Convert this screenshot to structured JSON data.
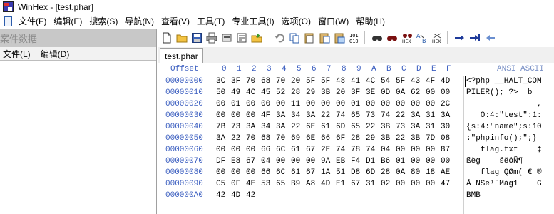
{
  "title": {
    "text": "WinHex - [test.phar]"
  },
  "menu": {
    "items": [
      "文件(F)",
      "编辑(E)",
      "搜索(S)",
      "导航(N)",
      "查看(V)",
      "工具(T)",
      "专业工具(I)",
      "选项(O)",
      "窗口(W)",
      "帮助(H)"
    ]
  },
  "left_panel": {
    "header": "案件数据",
    "menu": [
      "文件(L)",
      "编辑(D)"
    ]
  },
  "toolbar": {
    "icons": [
      "new-file-icon",
      "open-folder-icon",
      "save-icon",
      "print-icon",
      "properties-icon",
      "run-icon",
      "open-icon",
      "undo-icon",
      "copy-icon",
      "clipboard-icon",
      "paste-icon",
      "paste-write-icon",
      "binary-icon",
      "find-icon",
      "find-text-icon",
      "find-hex-icon",
      "replace-text-icon",
      "replace-hex-icon",
      "goto-offset-icon",
      "goto-icon",
      "back-icon"
    ]
  },
  "tab": {
    "label": "test.phar"
  },
  "hex": {
    "offset_header": "Offset",
    "col_headers": [
      "0",
      "1",
      "2",
      "3",
      "4",
      "5",
      "6",
      "7",
      "8",
      "9",
      "A",
      "B",
      "C",
      "D",
      "E",
      "F"
    ],
    "ascii_header": "ANSI ASCII",
    "rows": [
      {
        "offset": "00000000",
        "bytes": [
          "3C",
          "3F",
          "70",
          "68",
          "70",
          "20",
          "5F",
          "5F",
          "48",
          "41",
          "4C",
          "54",
          "5F",
          "43",
          "4F",
          "4D"
        ],
        "ascii": "<?php __HALT_COM"
      },
      {
        "offset": "00000010",
        "bytes": [
          "50",
          "49",
          "4C",
          "45",
          "52",
          "28",
          "29",
          "3B",
          "20",
          "3F",
          "3E",
          "0D",
          "0A",
          "62",
          "00",
          "00"
        ],
        "ascii": "PILER(); ?>  b"
      },
      {
        "offset": "00000020",
        "bytes": [
          "00",
          "01",
          "00",
          "00",
          "00",
          "11",
          "00",
          "00",
          "00",
          "01",
          "00",
          "00",
          "00",
          "00",
          "00",
          "2C"
        ],
        "ascii": "               ,"
      },
      {
        "offset": "00000030",
        "bytes": [
          "00",
          "00",
          "00",
          "4F",
          "3A",
          "34",
          "3A",
          "22",
          "74",
          "65",
          "73",
          "74",
          "22",
          "3A",
          "31",
          "3A"
        ],
        "ascii": "   O:4:\"test\":1:"
      },
      {
        "offset": "00000040",
        "bytes": [
          "7B",
          "73",
          "3A",
          "34",
          "3A",
          "22",
          "6E",
          "61",
          "6D",
          "65",
          "22",
          "3B",
          "73",
          "3A",
          "31",
          "30"
        ],
        "ascii": "{s:4:\"name\";s:10"
      },
      {
        "offset": "00000050",
        "bytes": [
          "3A",
          "22",
          "70",
          "68",
          "70",
          "69",
          "6E",
          "66",
          "6F",
          "28",
          "29",
          "3B",
          "22",
          "3B",
          "7D",
          "08"
        ],
        "ascii": ":\"phpinfo();\";}"
      },
      {
        "offset": "00000060",
        "bytes": [
          "00",
          "00",
          "00",
          "66",
          "6C",
          "61",
          "67",
          "2E",
          "74",
          "78",
          "74",
          "04",
          "00",
          "00",
          "00",
          "87"
        ],
        "ascii": "   flag.txt    ‡"
      },
      {
        "offset": "00000070",
        "bytes": [
          "DF",
          "E8",
          "67",
          "04",
          "00",
          "00",
          "00",
          "9A",
          "EB",
          "F4",
          "D1",
          "B6",
          "01",
          "00",
          "00",
          "00"
        ],
        "ascii": "ßèg    šëôÑ¶"
      },
      {
        "offset": "00000080",
        "bytes": [
          "00",
          "00",
          "00",
          "66",
          "6C",
          "61",
          "67",
          "1A",
          "51",
          "D8",
          "6D",
          "28",
          "0A",
          "80",
          "18",
          "AE"
        ],
        "ascii": "   flag QØm( € ®"
      },
      {
        "offset": "00000090",
        "bytes": [
          "C5",
          "0F",
          "4E",
          "53",
          "65",
          "B9",
          "A8",
          "4D",
          "E1",
          "67",
          "31",
          "02",
          "00",
          "00",
          "00",
          "47"
        ],
        "ascii": "Å NSe¹¨Mág1    G"
      },
      {
        "offset": "000000A0",
        "bytes": [
          "42",
          "4D",
          "42"
        ],
        "ascii": "BMB"
      }
    ]
  }
}
